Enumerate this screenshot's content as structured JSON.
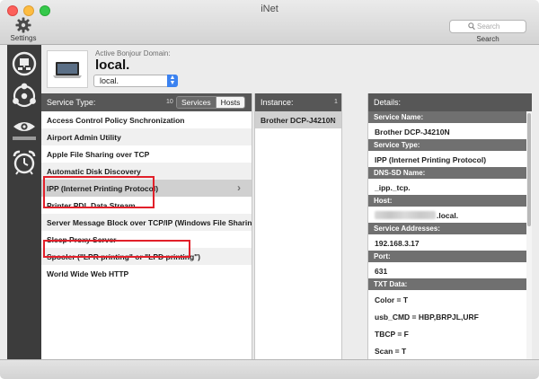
{
  "window": {
    "title": "iNet"
  },
  "toolbar": {
    "settings_label": "Settings",
    "search_placeholder": "Search",
    "search_label": "Search"
  },
  "sidebar": {
    "items": [
      {
        "icon": "network-icon"
      },
      {
        "icon": "bonjour-icon"
      },
      {
        "icon": "eye-icon"
      },
      {
        "icon": "alarm-clock-icon"
      }
    ]
  },
  "domain": {
    "caption": "Active Bonjour Domain:",
    "name": "local.",
    "selected": "local."
  },
  "services": {
    "header": "Service Type:",
    "count": "10",
    "toggle": [
      "Services",
      "Hosts"
    ],
    "items": [
      "Access Control Policy Snchronization",
      "Airport Admin Utility",
      "Apple File Sharing over TCP",
      "Automatic Disk Discovery",
      "IPP (Internet Printing Protocol)",
      "Printer PDL Data Stream",
      "Server Message Block over TCP/IP (Windows File Sharing)",
      "Sleep Proxy Server",
      "Spooler (\"LPR printing\" or \"LPD printing\")",
      "World Wide Web HTTP"
    ],
    "selected_index": 4
  },
  "instance": {
    "header": "Instance:",
    "count": "1",
    "items": [
      "Brother DCP-J4210N"
    ]
  },
  "details": {
    "header": "Details:",
    "fields": [
      {
        "label": "Service Name:",
        "value": "Brother DCP-J4210N"
      },
      {
        "label": "Service Type:",
        "value": "IPP (Internet Printing Protocol)"
      },
      {
        "label": "DNS-SD Name:",
        "value": "_ipp._tcp."
      },
      {
        "label": "Host:",
        "value": ".local."
      },
      {
        "label": "Service Addresses:",
        "value": "192.168.3.17"
      },
      {
        "label": "Port:",
        "value": "631"
      },
      {
        "label": "TXT Data:",
        "value": "Color = T"
      }
    ],
    "txt_extra": [
      "usb_CMD = HBP,BRPJL,URF",
      "TBCP = F",
      "Scan = T"
    ]
  },
  "colors": {
    "header_bg": "#575757",
    "label_bg": "#707070",
    "selection": "#d0d0d0",
    "annotation": "#e2202a"
  }
}
